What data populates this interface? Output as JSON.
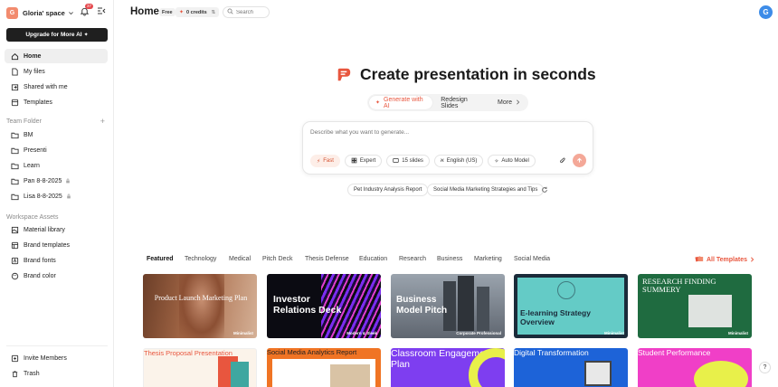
{
  "sidebar": {
    "space_initial": "G",
    "space_name": "Gloria' space",
    "notification_count": "37",
    "upgrade_label": "Upgrade for More AI",
    "nav": [
      {
        "label": "Home",
        "icon": "home-icon"
      },
      {
        "label": "My files",
        "icon": "file-icon"
      },
      {
        "label": "Shared with me",
        "icon": "share-icon"
      },
      {
        "label": "Templates",
        "icon": "template-icon"
      }
    ],
    "team_folder_label": "Team Folder",
    "folders": [
      {
        "label": "BM",
        "locked": false
      },
      {
        "label": "Presenti",
        "locked": false
      },
      {
        "label": "Learn",
        "locked": false
      },
      {
        "label": "Pan 8-8-2025",
        "locked": true
      },
      {
        "label": "Lisa 8-8-2025",
        "locked": true
      }
    ],
    "workspace_assets_label": "Workspace Assets",
    "assets": [
      {
        "label": "Material library"
      },
      {
        "label": "Brand templates"
      },
      {
        "label": "Brand fonts"
      },
      {
        "label": "Brand color"
      }
    ],
    "bottom": [
      {
        "label": "Invite Members"
      },
      {
        "label": "Trash"
      }
    ]
  },
  "header": {
    "title": "Home",
    "plan": "Free",
    "credits": "0 credits",
    "search_placeholder": "Search",
    "user_initial": "G"
  },
  "hero": {
    "title": "Create presentation in seconds",
    "tabs": [
      "Generate with AI",
      "Redesign Slides",
      "More"
    ]
  },
  "composer": {
    "placeholder": "Describe what you want to generate...",
    "chips": [
      "Fast",
      "Expert",
      "15 slides",
      "English (US)",
      "Auto Model"
    ]
  },
  "suggestions": [
    "Pet Industry Analysis Report",
    "Social Media Marketing Strategies and Tips"
  ],
  "categories": [
    "Featured",
    "Technology",
    "Medical",
    "Pitch Deck",
    "Thesis Defense",
    "Education",
    "Research",
    "Business",
    "Marketing",
    "Social Media"
  ],
  "all_templates_label": "All Templates",
  "templates_row1": [
    {
      "title": "Product Launch Marketing Plan",
      "tag": "Minimalist"
    },
    {
      "title": "Investor Relations Deck",
      "tag": "Modern & Sleek"
    },
    {
      "title": "Business Model Pitch",
      "tag": "Corporate Professional"
    },
    {
      "title": "E-learning Strategy Overview",
      "tag": "Minimalist"
    },
    {
      "title": "RESEARCH FINDING SUMMERY",
      "tag": "Minimalist"
    }
  ],
  "templates_row2": [
    {
      "title": "Thesis Proposal Presentation"
    },
    {
      "title": "Social Media Analytics Report"
    },
    {
      "title": "Classroom Engagement Plan"
    },
    {
      "title": "Digital Transformation"
    },
    {
      "title": "Student Performance"
    }
  ],
  "colors": {
    "accent": "#e8563e",
    "dark": "#1f1f1f"
  }
}
